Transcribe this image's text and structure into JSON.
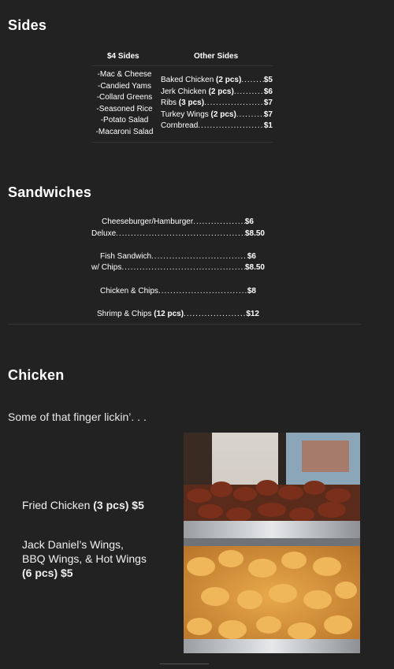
{
  "sides": {
    "title": "Sides",
    "col1_header": "$4 Sides",
    "col2_header": "Other Sides",
    "four_dollar": [
      "-Mac & Cheese",
      "-Candied Yams",
      "-Collard Greens",
      "-Seasoned Rice",
      "-Potato Salad",
      "-Macaroni Salad"
    ],
    "other": [
      {
        "name": "Baked Chicken",
        "qty": "(2 pcs)",
        "price": "$5"
      },
      {
        "name": "Jerk Chicken",
        "qty": "(2 pcs)",
        "price": "$6"
      },
      {
        "name": "Ribs",
        "qty": "(3 pcs)",
        "price": "$7"
      },
      {
        "name": "Turkey Wings",
        "qty": "(2 pcs)",
        "price": "$7"
      },
      {
        "name": "Cornbread",
        "qty": "",
        "price": "$1"
      }
    ]
  },
  "sandwiches": {
    "title": "Sandwiches",
    "items": [
      {
        "name": "Cheeseburger/Hamburger",
        "qty": "",
        "price": "$6"
      },
      {
        "name": "Deluxe",
        "qty": "",
        "price": "$8.50"
      },
      {
        "name": "Fish Sandwich",
        "qty": "",
        "price": "$6"
      },
      {
        "name": "w/ Chips",
        "qty": "",
        "price": "$8.50"
      },
      {
        "name": "Chicken & Chips",
        "qty": "",
        "price": "$8"
      },
      {
        "name": "Shrimp & Chips",
        "qty": "(12 pcs)",
        "price": "$12"
      }
    ]
  },
  "chicken": {
    "title": "Chicken",
    "intro": "Some of that finger lickin’. . .",
    "fried_name": "Fried Chicken",
    "fried_qty_price": "(3 pcs) $5",
    "wings_line1": "Jack Daniel’s Wings,",
    "wings_line2": "BBQ Wings, & Hot Wings",
    "wings_qty_price": "(6 pcs) $5"
  },
  "colors": {
    "background": "#222222",
    "text": "#ffffff",
    "rule": "#333333"
  }
}
